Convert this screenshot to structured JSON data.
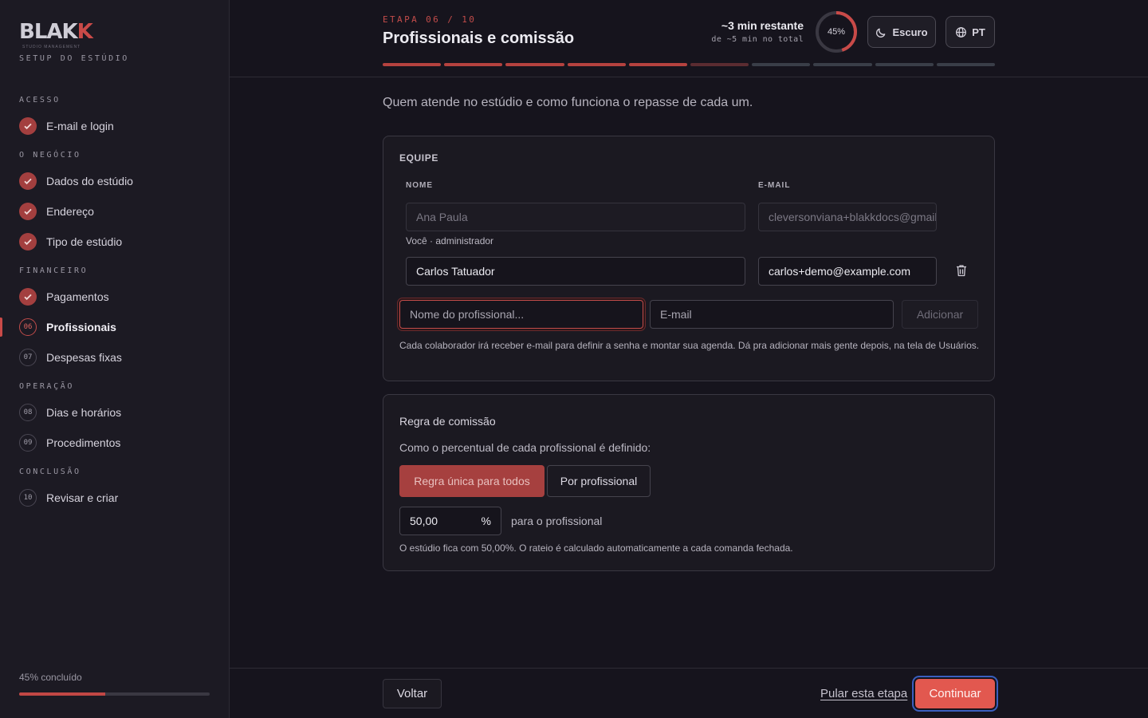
{
  "brand": {
    "logo_main": "BLAK",
    "logo_accent": "K",
    "logo_sub": "STUDIO MANAGEMENT",
    "setup_label": "SETUP DO ESTÚDIO"
  },
  "sidebar": {
    "sections": [
      {
        "label": "ACESSO"
      },
      {
        "label": "O NEGÓCIO"
      },
      {
        "label": "FINANCEIRO"
      },
      {
        "label": "OPERAÇÃO"
      },
      {
        "label": "CONCLUSÃO"
      }
    ],
    "items": [
      {
        "label": "E-mail e login",
        "state": "done"
      },
      {
        "label": "Dados do estúdio",
        "state": "done"
      },
      {
        "label": "Endereço",
        "state": "done"
      },
      {
        "label": "Tipo de estúdio",
        "state": "done"
      },
      {
        "label": "Pagamentos",
        "state": "done"
      },
      {
        "label": "Profissionais",
        "state": "current",
        "number": "06"
      },
      {
        "label": "Despesas fixas",
        "state": "pending",
        "number": "07"
      },
      {
        "label": "Dias e horários",
        "state": "pending",
        "number": "08"
      },
      {
        "label": "Procedimentos",
        "state": "pending",
        "number": "09"
      },
      {
        "label": "Revisar e criar",
        "state": "pending",
        "number": "10"
      }
    ],
    "progress_label": "45% concluído",
    "progress_fraction": 0.45
  },
  "header": {
    "step_label": "ETAPA 06 / 10",
    "title": "Profissionais e comissão",
    "time_remaining": "~3 min restante",
    "time_total": "de ~5 min no total",
    "ring_percent_label": "45%",
    "ring_fraction": 0.45,
    "theme_button": "Escuro",
    "lang_button": "PT",
    "total_steps": 10,
    "completed_steps": 5,
    "current_step": 6
  },
  "main": {
    "intro": "Quem atende no estúdio e como funciona o repasse de cada um.",
    "team": {
      "title": "EQUIPE",
      "col_name": "NOME",
      "col_email": "E-MAIL",
      "members": [
        {
          "name": "Ana Paula",
          "email": "cleversonviana+blakkdocs@gmail.com",
          "note": "Você · administrador"
        },
        {
          "name": "Carlos Tatuador",
          "email": "carlos+demo@example.com"
        }
      ],
      "new_name_placeholder": "Nome do profissional...",
      "new_email_placeholder": "E-mail",
      "add_button": "Adicionar",
      "hint": "Cada colaborador irá receber e-mail para definir a senha e montar sua agenda. Dá pra adicionar mais gente depois, na tela de Usuários."
    },
    "commission": {
      "title": "Regra de comissão",
      "question": "Como o percentual de cada profissional é definido:",
      "option_single": "Regra única para todos",
      "option_per": "Por profissional",
      "value": "50,00",
      "unit": "%",
      "value_label": "para o profissional",
      "note": "O estúdio fica com 50,00%. O rateio é calculado automaticamente a cada comanda fechada."
    }
  },
  "footer": {
    "back": "Voltar",
    "skip": "Pular esta etapa",
    "continue": "Continuar"
  },
  "colors": {
    "accent": "#c94a48",
    "continue_bg": "#e2584f",
    "background": "#16141d"
  }
}
